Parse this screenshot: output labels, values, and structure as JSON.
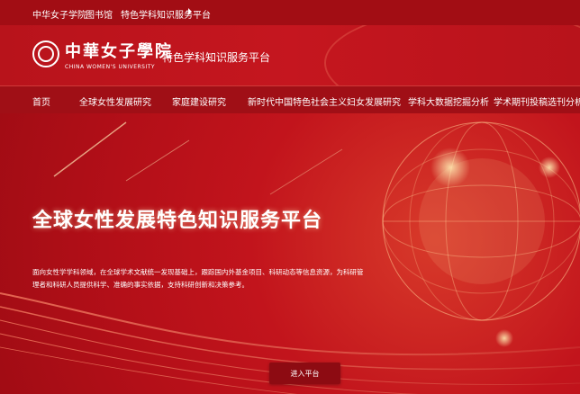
{
  "topbar": {
    "links": [
      "中华女子学院",
      "图书馆",
      "特色学科知识服务平台"
    ]
  },
  "header": {
    "logo_cn": "中華女子學院",
    "logo_en": "CHINA WOMEN'S UNIVERSITY",
    "platform_title": "特色学科知识服务平台"
  },
  "nav": {
    "items": [
      "首页",
      "全球女性发展研究",
      "家庭建设研究",
      "新时代中国特色社会主义妇女发展研究",
      "学科大数据挖掘分析",
      "学术期刊投稿选刊分析"
    ]
  },
  "hero": {
    "title": "全球女性发展特色知识服务平台",
    "description": "面向女性学学科领域，在全球学术文献统一发现基础上，跟踪国内外基金项目、科研动态等信息资源，为科研管理者和科研人员提供科学、准确的事实依据，支持科研创新和决策参考。",
    "enter_button": "进入平台"
  },
  "colors": {
    "primary_red": "#b5121b",
    "dark_red": "#a00f16",
    "button_red": "#8d0b12",
    "text": "#ffffff"
  }
}
